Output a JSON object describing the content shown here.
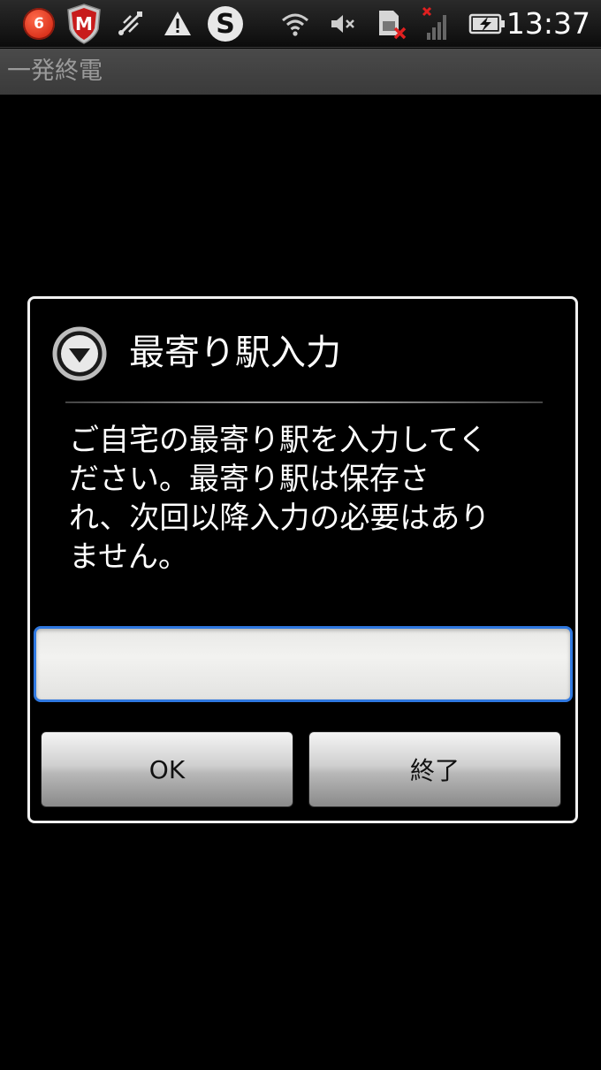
{
  "status_bar": {
    "notification_count": "6",
    "skype_letter": "S",
    "time": "13:37",
    "icons": [
      "notification-badge-icon",
      "mcafee-shield-icon",
      "usb-debug-icon",
      "warning-icon",
      "skype-icon",
      "wifi-icon",
      "mute-icon",
      "sim-error-icon",
      "no-signal-icon",
      "battery-charging-icon"
    ]
  },
  "app": {
    "title": "一発終電"
  },
  "dialog": {
    "title": "最寄り駅入力",
    "message": "ご自宅の最寄り駅を入力してく\nださい。最寄り駅は保存さ\nれ、次回以降入力の必要はあり\nません。",
    "input": {
      "value": "",
      "placeholder": ""
    },
    "ok_label": "OK",
    "exit_label": "終了"
  },
  "colors": {
    "input_focus_border": "#2f78e0",
    "badge_red": "#d8301a",
    "background": "#000000"
  }
}
